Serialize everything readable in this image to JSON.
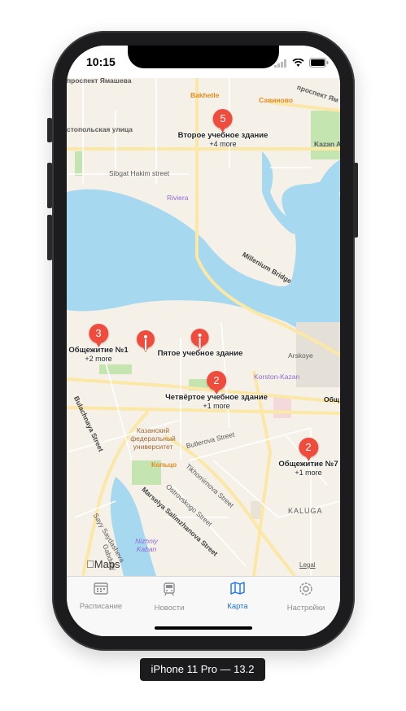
{
  "status_bar": {
    "time": "10:15"
  },
  "map": {
    "street_labels": [
      "проспект Ямашева",
      "Bakhetle",
      "Савиново",
      "проспект Ям",
      "стопольская улица",
      "Kazan Ar",
      "Sibgat Hakim street",
      "Riviera",
      "Millenium Bridge",
      "Arskoye",
      "Korston-Kazan",
      "Общ",
      "Казанский федеральный университет",
      "Butlerova Street",
      "Кольцо",
      "Tikhomirnova Street",
      "Ostrovskogo Street",
      "KALUGA",
      "Marselya Salimzhanova Street",
      "Nizhniy Kaban",
      "Bulachnaya Street",
      "Gabdully",
      "Sayy Saydasheva"
    ],
    "clusters": [
      {
        "count": "5",
        "title": "Второе учебное здание",
        "more": "+4 more"
      },
      {
        "count": "3",
        "title": "Общежитие №1",
        "more": "+2 more"
      },
      {
        "count": "",
        "title": "",
        "more": ""
      },
      {
        "count": "",
        "title": "Пятое учебное здание",
        "more": ""
      },
      {
        "count": "2",
        "title": "Четвёртое учебное здание",
        "more": "+1 more"
      },
      {
        "count": "2",
        "title": "Общежитие №7",
        "more": "+1 more"
      }
    ],
    "attribution": "Maps",
    "legal": "Legal",
    "colors": {
      "water": "#a6d8f0",
      "land": "#f6f1e8",
      "park": "#c5e5b0",
      "road": "#fbe7a6",
      "pin": "#f04c3e"
    }
  },
  "tabbar": {
    "tabs": [
      {
        "label": "Расписание",
        "icon": "calendar-icon",
        "active": false
      },
      {
        "label": "Новости",
        "icon": "tram-icon",
        "active": false
      },
      {
        "label": "Карта",
        "icon": "map-icon",
        "active": true
      },
      {
        "label": "Настройки",
        "icon": "gear-icon",
        "active": false
      }
    ],
    "active_color": "#1a73e8"
  },
  "device_caption": "iPhone 11 Pro — 13.2"
}
